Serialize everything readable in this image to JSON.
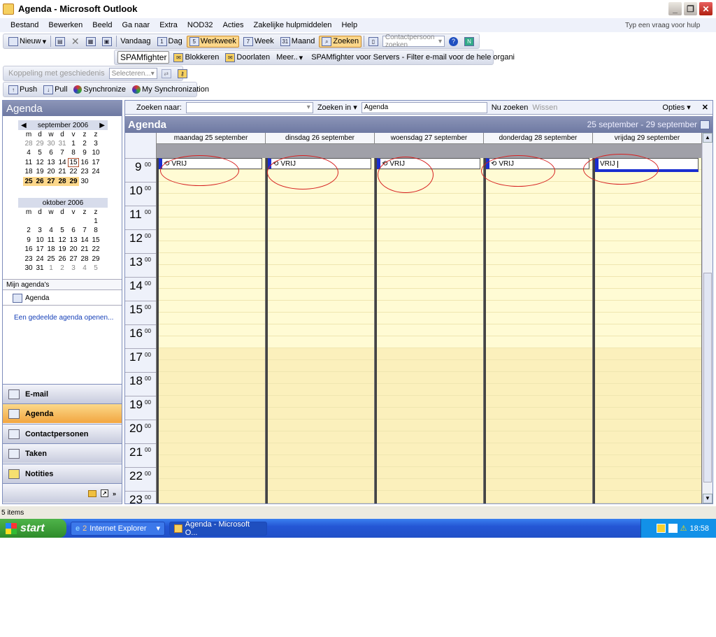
{
  "window": {
    "title": "Agenda - Microsoft Outlook",
    "help_placeholder": "Typ een vraag voor hulp"
  },
  "menu": [
    "Bestand",
    "Bewerken",
    "Beeld",
    "Ga naar",
    "Extra",
    "NOD32",
    "Acties",
    "Zakelijke hulpmiddelen",
    "Help"
  ],
  "toolbar1": {
    "new": "Nieuw",
    "today": "Vandaag",
    "day": "Dag",
    "workweek": "Werkweek",
    "week": "Week",
    "month": "Maand",
    "find": "Zoeken",
    "contact_search": "Contactpersoon zoeken"
  },
  "toolbar2": {
    "logo": "SPAMfighter",
    "block": "Blokkeren",
    "allow": "Doorlaten",
    "more": "Meer..",
    "promo": "SPAMfighter voor Servers - Filter e-mail voor de hele organi"
  },
  "toolbar3": {
    "history": "Koppeling met geschiedenis",
    "select": "Selecteren..."
  },
  "toolbar4": {
    "push": "Push",
    "pull": "Pull",
    "sync": "Synchronize",
    "mysync": "My Synchronization"
  },
  "nav": {
    "header": "Agenda",
    "my_calendars": "Mijn agenda's",
    "calendar_item": "Agenda",
    "open_shared": "Een gedeelde agenda openen...",
    "sept": {
      "title": "september 2006",
      "days": [
        "m",
        "d",
        "w",
        "d",
        "v",
        "z",
        "z"
      ],
      "cells": [
        [
          "28",
          "o"
        ],
        [
          "29",
          "o"
        ],
        [
          "30",
          "o"
        ],
        [
          "31",
          "o"
        ],
        [
          "1",
          ""
        ],
        [
          "2",
          ""
        ],
        [
          "3",
          ""
        ],
        [
          "4",
          ""
        ],
        [
          "5",
          ""
        ],
        [
          "6",
          ""
        ],
        [
          "7",
          ""
        ],
        [
          "8",
          ""
        ],
        [
          "9",
          ""
        ],
        [
          "10",
          ""
        ],
        [
          "11",
          ""
        ],
        [
          "12",
          ""
        ],
        [
          "13",
          ""
        ],
        [
          "14",
          ""
        ],
        [
          "15",
          "today"
        ],
        [
          "16",
          ""
        ],
        [
          "17",
          ""
        ],
        [
          "18",
          ""
        ],
        [
          "19",
          ""
        ],
        [
          "20",
          ""
        ],
        [
          "21",
          ""
        ],
        [
          "22",
          ""
        ],
        [
          "23",
          ""
        ],
        [
          "24",
          ""
        ],
        [
          "25",
          "sel"
        ],
        [
          "26",
          "sel"
        ],
        [
          "27",
          "sel"
        ],
        [
          "28",
          "sel"
        ],
        [
          "29",
          "sel"
        ],
        [
          "30",
          ""
        ]
      ]
    },
    "oct": {
      "title": "oktober 2006",
      "days": [
        "m",
        "d",
        "w",
        "d",
        "v",
        "z",
        "z"
      ],
      "cells": [
        [
          "",
          ""
        ],
        [
          "",
          ""
        ],
        [
          "",
          ""
        ],
        [
          "",
          ""
        ],
        [
          "",
          ""
        ],
        [
          "",
          ""
        ],
        [
          "1",
          ""
        ],
        [
          "2",
          ""
        ],
        [
          "3",
          ""
        ],
        [
          "4",
          ""
        ],
        [
          "5",
          ""
        ],
        [
          "6",
          ""
        ],
        [
          "7",
          ""
        ],
        [
          "8",
          ""
        ],
        [
          "9",
          ""
        ],
        [
          "10",
          ""
        ],
        [
          "11",
          ""
        ],
        [
          "12",
          ""
        ],
        [
          "13",
          ""
        ],
        [
          "14",
          ""
        ],
        [
          "15",
          ""
        ],
        [
          "16",
          ""
        ],
        [
          "17",
          ""
        ],
        [
          "18",
          ""
        ],
        [
          "19",
          ""
        ],
        [
          "20",
          ""
        ],
        [
          "21",
          ""
        ],
        [
          "22",
          ""
        ],
        [
          "23",
          ""
        ],
        [
          "24",
          ""
        ],
        [
          "25",
          ""
        ],
        [
          "26",
          ""
        ],
        [
          "27",
          ""
        ],
        [
          "28",
          ""
        ],
        [
          "29",
          ""
        ],
        [
          "30",
          ""
        ],
        [
          "31",
          ""
        ],
        [
          "1",
          "o"
        ],
        [
          "2",
          "o"
        ],
        [
          "3",
          "o"
        ],
        [
          "4",
          "o"
        ],
        [
          "5",
          "o"
        ]
      ]
    },
    "buttons": [
      "E-mail",
      "Agenda",
      "Contactpersonen",
      "Taken",
      "Notities"
    ]
  },
  "search": {
    "label": "Zoeken naar:",
    "in_label": "Zoeken in",
    "in_value": "Agenda",
    "go": "Nu zoeken",
    "clear": "Wissen",
    "options": "Opties"
  },
  "calendar": {
    "title": "Agenda",
    "range": "25 september - 29 september",
    "days": [
      "maandag 25 september",
      "dinsdag 26 september",
      "woensdag 27 september",
      "donderdag 28 september",
      "vrijdag 29 september"
    ],
    "hours": [
      "9",
      "10",
      "11",
      "12",
      "13",
      "14",
      "15",
      "16",
      "17",
      "18",
      "19",
      "20",
      "21",
      "22",
      "23"
    ],
    "minutes": "00",
    "appointments": [
      "VRIJ",
      "VRIJ",
      "VRIJ",
      "VRIJ",
      "VRIJ"
    ]
  },
  "status": {
    "items": "5 items"
  },
  "taskbar": {
    "start": "start",
    "ie": "Internet Explorer",
    "ie_count": "2",
    "outlook": "Agenda - Microsoft O...",
    "clock": "18:58"
  }
}
